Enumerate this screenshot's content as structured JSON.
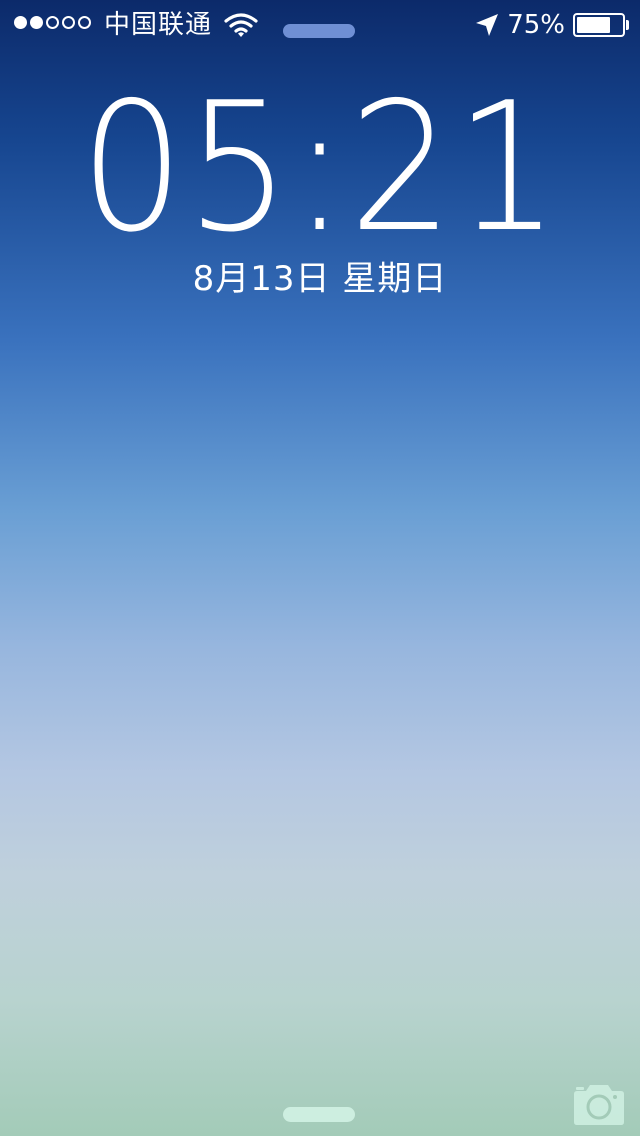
{
  "status_bar": {
    "signal_strength": 2,
    "signal_max": 5,
    "carrier": "中国联通",
    "battery_percent_text": "75%",
    "battery_level": 0.75,
    "icons": [
      "signal-dots",
      "wifi-icon",
      "location-arrow-icon",
      "battery-icon"
    ]
  },
  "lock_screen": {
    "time": "05:21",
    "date": "8月13日 星期日"
  },
  "bottom": {
    "icons": [
      "unlock-grabber",
      "camera-icon"
    ]
  },
  "colors": {
    "gradient_top": "#0c2a6a",
    "gradient_mid": "#97b6de",
    "gradient_bottom": "#a3cbb8",
    "text": "#ffffff"
  }
}
